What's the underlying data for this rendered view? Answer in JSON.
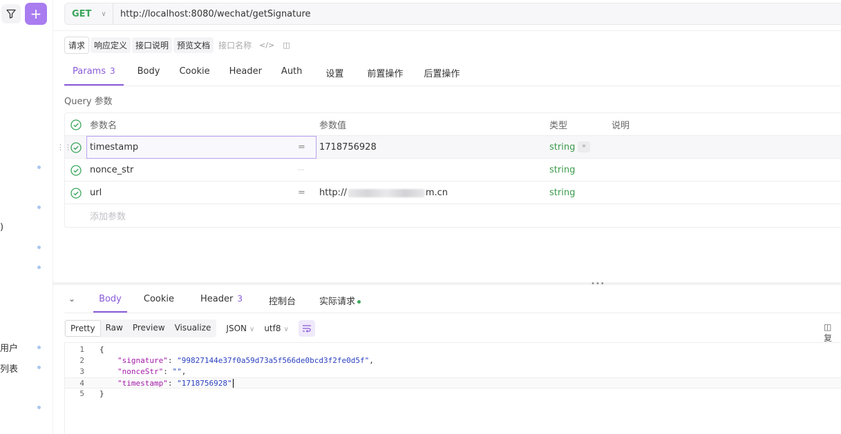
{
  "sidebar": {
    "partial_texts": [
      ")",
      "用户",
      "列表"
    ]
  },
  "request": {
    "method": "GET",
    "url": "http://localhost:8080/wechat/getSignature"
  },
  "subtabs": [
    "请求",
    "响应定义",
    "接口说明",
    "预览文档"
  ],
  "subtab_placeholder": "接口名称",
  "tabs": [
    {
      "label": "Params",
      "count": "3"
    },
    {
      "label": "Body"
    },
    {
      "label": "Cookie"
    },
    {
      "label": "Header"
    },
    {
      "label": "Auth"
    },
    {
      "label": "设置"
    },
    {
      "label": "前置操作"
    },
    {
      "label": "后置操作"
    }
  ],
  "query_label": "Query 参数",
  "params_header": {
    "name": "参数名",
    "value": "参数值",
    "type": "类型",
    "desc": "说明"
  },
  "params": [
    {
      "name": "timestamp",
      "value": "1718756928",
      "type": "string"
    },
    {
      "name": "nonce_str",
      "value": "",
      "type": "string"
    },
    {
      "name": "url",
      "value_prefix": "http://",
      "value_suffix": "m.cn",
      "type": "string"
    }
  ],
  "add_param": "添加参数",
  "required_mark": "*",
  "response_tabs": [
    {
      "label": "Body"
    },
    {
      "label": "Cookie"
    },
    {
      "label": "Header",
      "count": "3"
    },
    {
      "label": "控制台"
    },
    {
      "label": "实际请求"
    }
  ],
  "format_buttons": [
    "Pretty",
    "Raw",
    "Preview",
    "Visualize"
  ],
  "format_type": "JSON",
  "encoding": "utf8",
  "copy_label": "复",
  "code": {
    "line_numbers": [
      "1",
      "2",
      "3",
      "4",
      "5"
    ],
    "open_brace": "{",
    "close_brace": "}",
    "entries": [
      {
        "key": "\"signature\"",
        "value": "\"99827144e37f0a59d73a5f566de0bcd3f2fe0d5f\"",
        "trail": ","
      },
      {
        "key": "\"nonceStr\"",
        "value": "\"\"",
        "trail": ","
      },
      {
        "key": "\"timestamp\"",
        "value": "\"1718756928\"",
        "trail": ""
      }
    ]
  },
  "colors": {
    "accent": "#8a5ad8",
    "method": "#3ca55c",
    "type": "#3a9a4a"
  }
}
